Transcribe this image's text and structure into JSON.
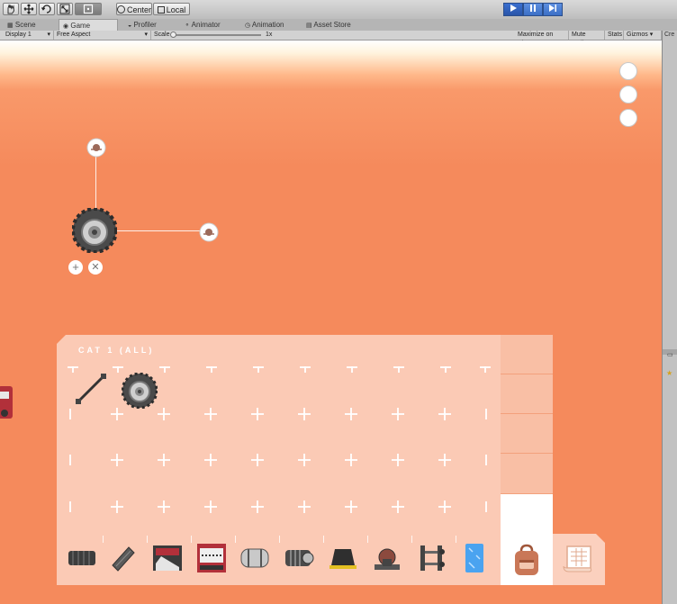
{
  "toolbar": {
    "tools": [
      "hand-icon",
      "move-icon",
      "rotate-icon",
      "scale-icon",
      "rect-icon"
    ],
    "pivot_label": "Center",
    "space_label": "Local",
    "play_controls": [
      "play-icon",
      "pause-icon",
      "step-icon"
    ]
  },
  "tabs": [
    {
      "label": "Scene"
    },
    {
      "label": "Game"
    },
    {
      "label": "Profiler"
    },
    {
      "label": "Animator"
    },
    {
      "label": "Animation"
    },
    {
      "label": "Asset Store"
    }
  ],
  "gamebar": {
    "display": "Display 1",
    "aspect": "Free Aspect",
    "scale_label": "Scale",
    "scale_value": "1x",
    "maximize": "Maximize on Play",
    "mute": "Mute audio",
    "stats": "Stats",
    "gizmos": "Gizmos"
  },
  "rightpanel": {
    "label": "Cre"
  },
  "inventory": {
    "category_title": "CAT 1 (ALL)",
    "slots_filled": [
      "strut-icon",
      "wheel-icon"
    ],
    "category_icons": [
      "track-icon",
      "plank-icon",
      "sawblade-icon",
      "crate-icon",
      "barrel-icon",
      "engine-icon",
      "block-icon",
      "anchor-icon",
      "frame-icon",
      "ice-block-icon"
    ],
    "side_tabs": 4,
    "bag_icon": "backpack-icon",
    "scroll_icon": "blueprint-icon"
  },
  "colors": {
    "ground": "#f58a5c",
    "accent_blue": "#3b6fc6"
  }
}
